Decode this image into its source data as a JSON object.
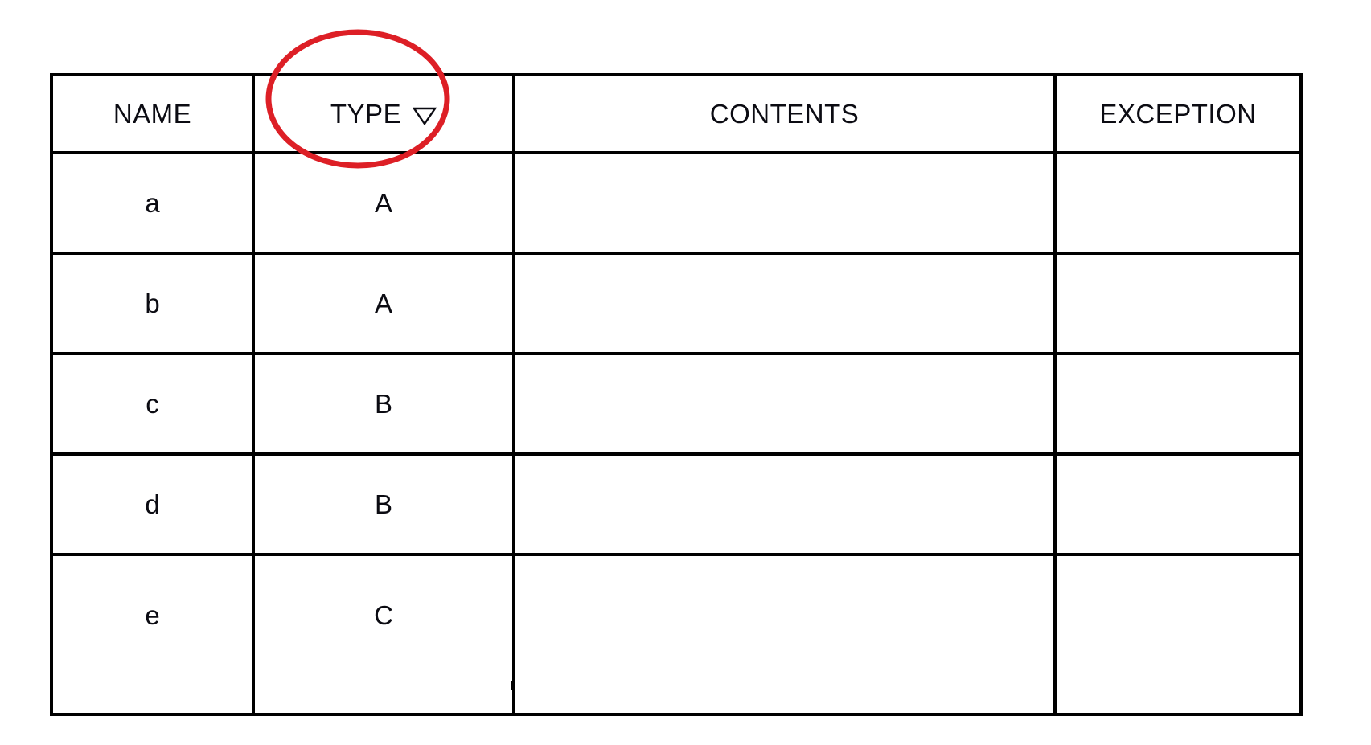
{
  "table": {
    "columns": [
      {
        "key": "name",
        "label": "NAME",
        "sort_indicator": null
      },
      {
        "key": "type",
        "label": "TYPE",
        "sort_indicator": "triangle-down-icon"
      },
      {
        "key": "contents",
        "label": "CONTENTS",
        "sort_indicator": null
      },
      {
        "key": "exception",
        "label": "EXCEPTION",
        "sort_indicator": null
      }
    ],
    "rows": [
      {
        "name": "a",
        "type": "A",
        "contents": "",
        "exception": ""
      },
      {
        "name": "b",
        "type": "A",
        "contents": "",
        "exception": ""
      },
      {
        "name": "c",
        "type": "B",
        "contents": "",
        "exception": ""
      },
      {
        "name": "d",
        "type": "B",
        "contents": "",
        "exception": ""
      },
      {
        "name": "e",
        "type": "C",
        "contents": "",
        "exception": ""
      }
    ]
  },
  "annotation": {
    "shape": "ellipse",
    "target": "TYPE",
    "color": "#dd1f26",
    "stroke_width": 7
  },
  "colors": {
    "border": "#000000",
    "text": "#0b0b12",
    "background": "#ffffff",
    "annotation_red": "#dd1f26"
  }
}
